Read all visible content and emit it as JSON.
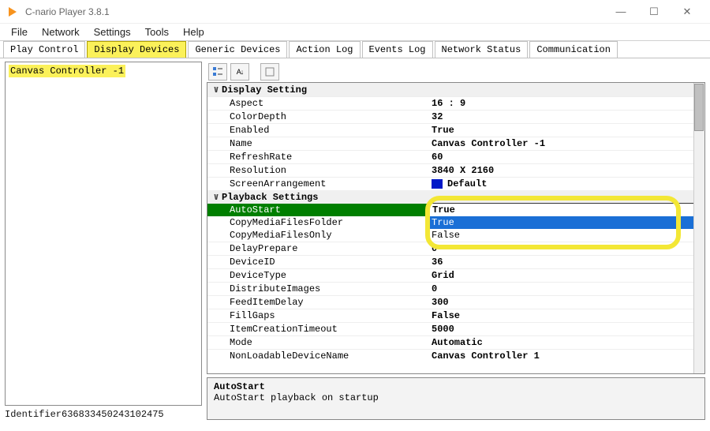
{
  "window": {
    "title": "C-nario Player 3.8.1"
  },
  "menu": {
    "file": "File",
    "network": "Network",
    "settings": "Settings",
    "tools": "Tools",
    "help": "Help"
  },
  "tabs": {
    "play_control": "Play Control",
    "display_devices": "Display Devices",
    "generic_devices": "Generic Devices",
    "action_log": "Action Log",
    "events_log": "Events Log",
    "network_status": "Network Status",
    "communication": "Communication"
  },
  "tree": {
    "item0": "Canvas Controller -1"
  },
  "identifier": "Identifier636833450243102475",
  "sections": {
    "display_setting": "Display Setting",
    "playback_settings": "Playback Settings"
  },
  "props": {
    "aspect": {
      "label": "Aspect",
      "value": "16 : 9"
    },
    "colordepth": {
      "label": "ColorDepth",
      "value": "32"
    },
    "enabled": {
      "label": "Enabled",
      "value": "True"
    },
    "name": {
      "label": "Name",
      "value": "Canvas Controller -1"
    },
    "refreshrate": {
      "label": "RefreshRate",
      "value": "60"
    },
    "resolution": {
      "label": "Resolution",
      "value": "3840 X 2160"
    },
    "screenarrangement": {
      "label": "ScreenArrangement",
      "value": "Default",
      "swatch": "#0018c8"
    },
    "autostart": {
      "label": "AutoStart",
      "value": "True",
      "opt_true": "True",
      "opt_false": "False"
    },
    "copymediafilesfolder": {
      "label": "CopyMediaFilesFolder",
      "value": ""
    },
    "copymediafilesonly": {
      "label": "CopyMediaFilesOnly",
      "value": ""
    },
    "delayprepare": {
      "label": "DelayPrepare",
      "value": "0"
    },
    "deviceid": {
      "label": "DeviceID",
      "value": "36"
    },
    "devicetype": {
      "label": "DeviceType",
      "value": "Grid"
    },
    "distributeimages": {
      "label": "DistributeImages",
      "value": "0"
    },
    "feeditemdelay": {
      "label": "FeedItemDelay",
      "value": "300"
    },
    "fillgaps": {
      "label": "FillGaps",
      "value": "False"
    },
    "itemcreationtimeout": {
      "label": "ItemCreationTimeout",
      "value": "5000"
    },
    "mode": {
      "label": "Mode",
      "value": "Automatic"
    },
    "nonloadabledevicename": {
      "label": "NonLoadableDeviceName",
      "value": "Canvas Controller 1"
    }
  },
  "desc": {
    "title": "AutoStart",
    "text": "AutoStart playback on startup"
  }
}
